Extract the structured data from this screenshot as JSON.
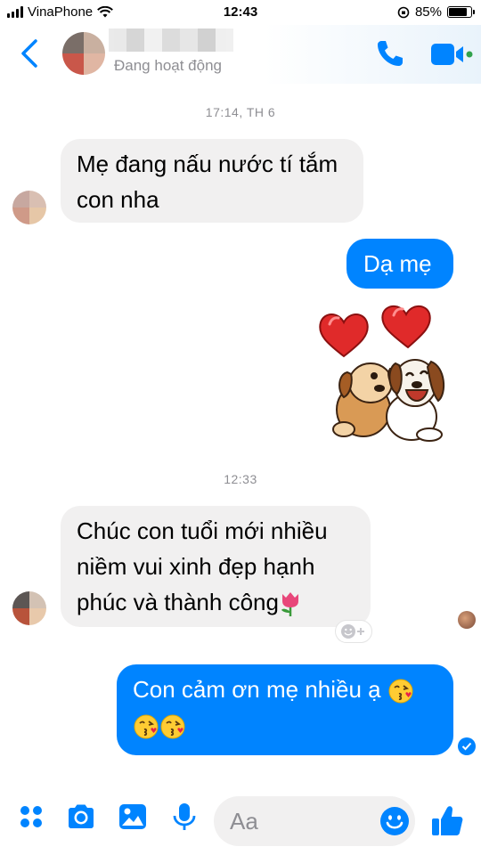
{
  "status_bar": {
    "carrier": "VinaPhone",
    "time": "12:43",
    "battery_text": "85%",
    "battery_level": 0.85
  },
  "header": {
    "subtitle": "Đang hoạt động"
  },
  "chat": {
    "timestamp_1": "17:14, TH 6",
    "msg_1_line_1": "Mẹ đang nấu nước tí tắm",
    "msg_1_line_2": "con nha",
    "msg_2": "Dạ mẹ",
    "timestamp_2": "12:33",
    "msg_3_line_1": "Chúc con tuổi mới nhiều",
    "msg_3_line_2": "niềm vui xinh đẹp hạnh",
    "msg_3_line_3": "phúc và thành công",
    "msg_4_line_1": "Con cảm ơn mẹ nhiều ạ"
  },
  "composer": {
    "placeholder": "Aa"
  },
  "colors": {
    "messenger_blue": "#0084ff",
    "incoming_bubble": "#f1f0f0",
    "secondary_text": "#8e8e93",
    "online_green": "#31a24c"
  },
  "icons": [
    "back-chevron-icon",
    "phone-icon",
    "video-camera-icon",
    "apps-grid-icon",
    "camera-icon",
    "gallery-icon",
    "microphone-icon",
    "smiley-icon",
    "thumbs-up-icon",
    "tulip-emoji",
    "kissing-face-emoji",
    "hearts-dogs-sticker"
  ]
}
